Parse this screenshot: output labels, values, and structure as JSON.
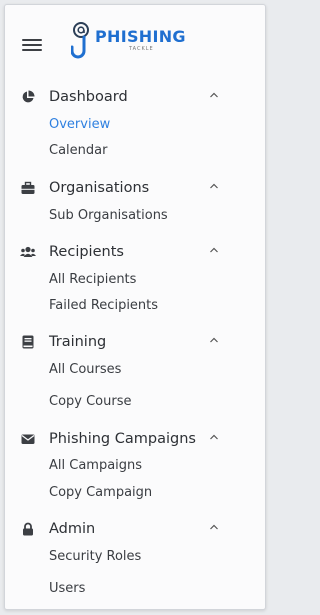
{
  "menu": {
    "toggle_icon": "hamburger-icon"
  },
  "logo": {
    "text": "PHISHING",
    "subtext": "TACKLE",
    "icon": "hook-logo-icon",
    "color": "#1f6fd0"
  },
  "sections": [
    {
      "label": "Dashboard",
      "icon": "pie-chart-icon",
      "expanded": true,
      "items": [
        {
          "label": "Overview",
          "active": true
        },
        {
          "label": "Calendar"
        }
      ]
    },
    {
      "label": "Organisations",
      "icon": "briefcase-icon",
      "expanded": true,
      "items": [
        {
          "label": "Sub Organisations"
        }
      ]
    },
    {
      "label": "Recipients",
      "icon": "users-icon",
      "expanded": true,
      "items": [
        {
          "label": "All Recipients"
        },
        {
          "label": "Failed Recipients"
        }
      ]
    },
    {
      "label": "Training",
      "icon": "book-icon",
      "expanded": true,
      "items": [
        {
          "label": "All Courses"
        },
        {
          "label": "Copy Course"
        }
      ]
    },
    {
      "label": "Phishing Campaigns",
      "icon": "envelope-icon",
      "expanded": true,
      "items": [
        {
          "label": "All Campaigns"
        },
        {
          "label": "Copy Campaign"
        }
      ]
    },
    {
      "label": "Admin",
      "icon": "lock-icon",
      "expanded": true,
      "items": [
        {
          "label": "Security Roles"
        },
        {
          "label": "Users"
        }
      ]
    }
  ],
  "colors": {
    "active_link": "#2f80e0",
    "text": "#2d3035",
    "panel": "#fbfbfc"
  }
}
